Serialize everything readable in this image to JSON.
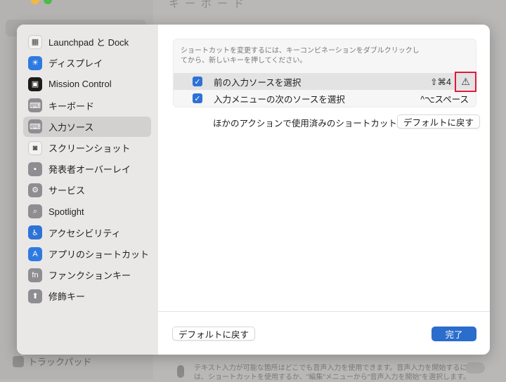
{
  "background": {
    "title": "キーボード",
    "sidebar_item": "トラックパッド",
    "dictation_text": "テキスト入力が可能な箇所はどこでも音声入力を使用できます。音声入力を開始するには、ショートカットを使用するか、\"編集\"メニューから\"音声入力を開始\"を選択します。"
  },
  "sidebar": {
    "items": [
      {
        "label": "Launchpad と Dock",
        "icon": "launchpad-icon",
        "color": "#f2f2f2"
      },
      {
        "label": "ディスプレイ",
        "icon": "display-icon",
        "color": "#2f7ae0"
      },
      {
        "label": "Mission Control",
        "icon": "mission-control-icon",
        "color": "#1b1b1b"
      },
      {
        "label": "キーボード",
        "icon": "keyboard-icon",
        "color": "#8e8e92"
      },
      {
        "label": "入力ソース",
        "icon": "keyboard-icon",
        "color": "#8e8e92",
        "selected": true
      },
      {
        "label": "スクリーンショット",
        "icon": "screenshot-icon",
        "color": "#f2f2f2"
      },
      {
        "label": "発表者オーバーレイ",
        "icon": "presenter-icon",
        "color": "#8e8e92"
      },
      {
        "label": "サービス",
        "icon": "gears-icon",
        "color": "#8e8e92"
      },
      {
        "label": "Spotlight",
        "icon": "search-icon",
        "color": "#8e8e92"
      },
      {
        "label": "アクセシビリティ",
        "icon": "accessibility-icon",
        "color": "#2f72d6"
      },
      {
        "label": "アプリのショートカット",
        "icon": "app-store-icon",
        "color": "#2f7ae0"
      },
      {
        "label": "ファンクションキー",
        "icon": "fn-icon",
        "color": "#8e8e92"
      },
      {
        "label": "修飾キー",
        "icon": "arrow-up-icon",
        "color": "#8e8e92"
      }
    ]
  },
  "main": {
    "hint": "ショートカットを変更するには、キーコンビネーションをダブルクリックしてから、新しいキーを押してください。",
    "shortcuts": [
      {
        "label": "前の入力ソースを選択",
        "keys": "⇧⌘4",
        "checked": true,
        "conflict": true
      },
      {
        "label": "入力メニューの次のソースを選択",
        "keys": "^⌥スペース",
        "checked": true
      }
    ],
    "conflict_text": "ほかのアクションで使用済みのショートカット",
    "restore_conflict_label": "デフォルトに戻す",
    "restore_all_label": "デフォルトに戻す",
    "done_label": "完了"
  },
  "colors": {
    "accent": "#2a6dcc",
    "warning_highlight": "#e0183c"
  }
}
